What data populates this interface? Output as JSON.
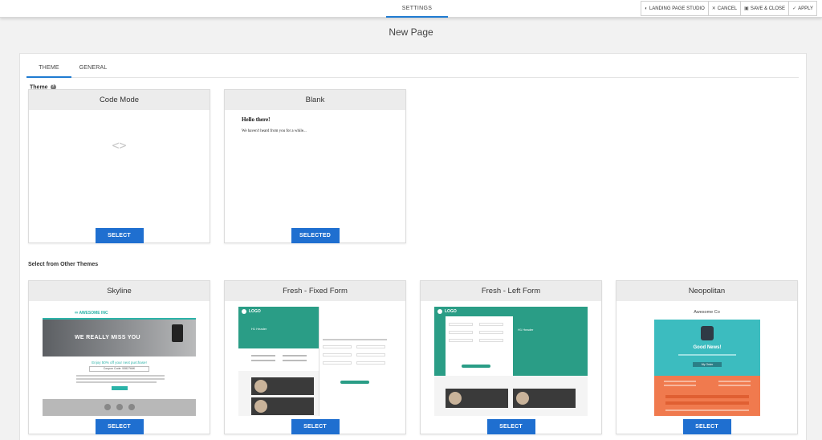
{
  "topbar": {
    "center_tab": "SETTINGS",
    "actions": {
      "studio": "LANDING PAGE STUDIO",
      "cancel": "CANCEL",
      "save_close": "SAVE & CLOSE",
      "apply": "APPLY"
    }
  },
  "page": {
    "title": "New Page"
  },
  "tabs": {
    "theme": "THEME",
    "general": "GENERAL"
  },
  "theme_section": {
    "label": "Theme",
    "cards": [
      {
        "title": "Code Mode",
        "button": "SELECT"
      },
      {
        "title": "Blank",
        "button": "SELECTED",
        "hello": "Hello there!",
        "message": "We haven't heard from you for a while..."
      }
    ]
  },
  "other_section": {
    "label": "Select from Other Themes",
    "cards": [
      {
        "title": "Skyline",
        "button": "SELECT",
        "preview_brand": "AWESOME INC",
        "preview_headline": "WE REALLY MISS YOU",
        "preview_offer": "Enjoy 50% off your next purchase!",
        "preview_code": "Coupon Code: 5382766K"
      },
      {
        "title": "Fresh - Fixed Form",
        "button": "SELECT",
        "preview_logo": "LOGO",
        "preview_header": "H1 Header"
      },
      {
        "title": "Fresh - Left Form",
        "button": "SELECT",
        "preview_logo": "LOGO",
        "preview_header": "H1 Header"
      },
      {
        "title": "Neopolitan",
        "button": "SELECT",
        "preview_company": "Awesome Co",
        "preview_news": "Good News!",
        "preview_cta": "My Order"
      }
    ]
  },
  "colors": {
    "accent": "#1f6fd0",
    "skyline_teal": "#2bb3a8",
    "fresh_green": "#2a9d86",
    "neo_teal": "#3cbcbf",
    "neo_orange": "#f07a4e"
  },
  "icons": {
    "studio": "palette-icon",
    "cancel": "close-icon",
    "save_close": "save-icon",
    "apply": "check-icon",
    "code": "code-brackets-icon",
    "help": "help-circle-icon"
  }
}
